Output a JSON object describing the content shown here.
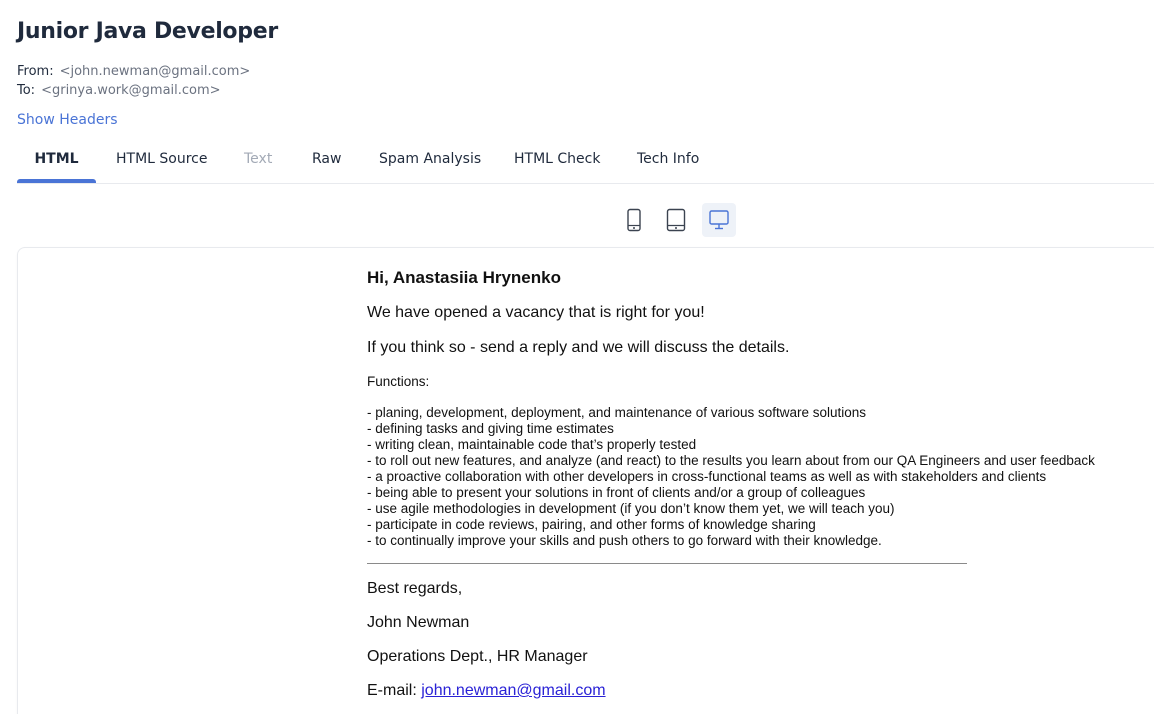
{
  "message": {
    "subject": "Junior Java Developer",
    "from_label": "From:",
    "from_address": "<john.newman@gmail.com>",
    "to_label": "To:",
    "to_address": "<grinya.work@gmail.com>",
    "show_headers": "Show Headers"
  },
  "tabs": [
    {
      "label": "HTML",
      "state": "active"
    },
    {
      "label": "HTML Source",
      "state": "normal"
    },
    {
      "label": "Text",
      "state": "disabled"
    },
    {
      "label": "Raw",
      "state": "normal"
    },
    {
      "label": "Spam Analysis",
      "state": "normal"
    },
    {
      "label": "HTML Check",
      "state": "normal"
    },
    {
      "label": "Tech Info",
      "state": "normal"
    }
  ],
  "device_toggle": {
    "options": [
      "mobile-icon",
      "tablet-icon",
      "desktop-icon"
    ],
    "selected": "desktop-icon"
  },
  "email": {
    "greeting": "Hi, Anastasiia Hrynenko",
    "para1": "We have opened a vacancy that is right for you!",
    "para2": "If you think so - send a reply and we will discuss the details.",
    "functions_heading": "Functions:",
    "functions": [
      "- planing, development, deployment, and maintenance of various software solutions",
      "- defining tasks and giving time estimates",
      "- writing clean, maintainable code that’s properly tested",
      "- to roll out new features, and analyze (and react) to the results you learn about from our QA Engineers and user feedback",
      "- a proactive collaboration with other developers in cross-functional teams as well as with stakeholders and clients",
      "- being able to present your solutions in front of clients and/or a group of colleagues",
      "- use agile methodologies in development (if you don’t know them yet, we will teach you)",
      "- participate in code reviews, pairing, and other forms of knowledge sharing",
      "- to continually improve your skills and push others to go forward with their knowledge."
    ],
    "regards": "Best regards,",
    "signature_name": "John Newman",
    "signature_role": "Operations Dept., HR Manager",
    "email_label": "E-mail:",
    "email_link": "john.newman@gmail.com"
  },
  "colors": {
    "accent": "#4a74d6",
    "text": "#1f2a3c",
    "muted": "#6b7280",
    "disabled": "#a3aab6",
    "link": "#2a22d6"
  }
}
